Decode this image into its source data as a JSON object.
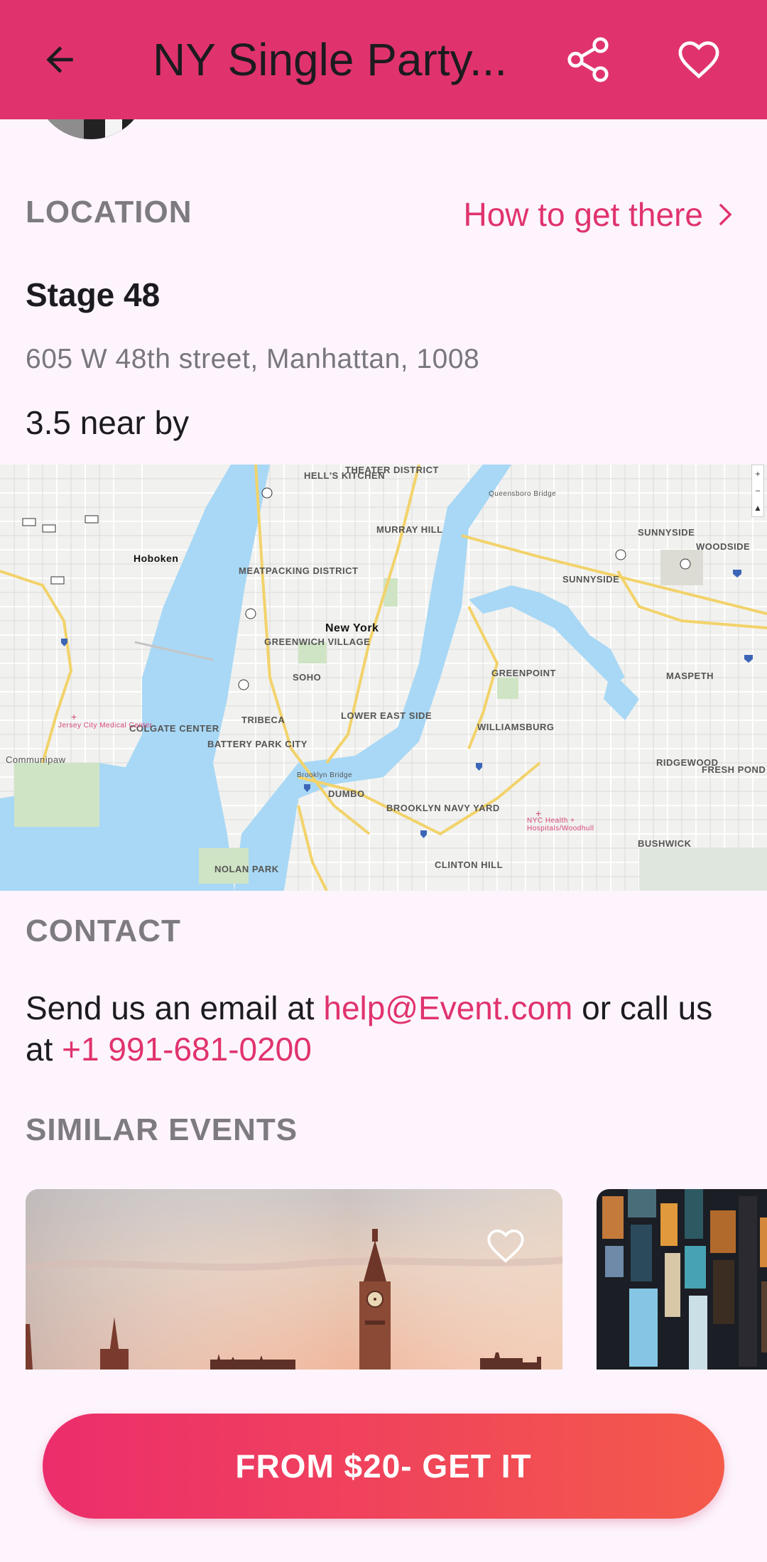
{
  "header": {
    "title": "NY Single Party...",
    "bar_color": "#e0336d"
  },
  "location": {
    "section_label": "LOCATION",
    "directions_link": "How to get there",
    "venue_name": "Stage 48",
    "address": "605 W 48th street, Manhattan, 1008",
    "distance": "3.5 near by"
  },
  "map": {
    "labels": {
      "hells_kitchen": "HELL'S KITCHEN",
      "theater_district": "THEATER DISTRICT",
      "murray_hill": "MURRAY HILL",
      "hoboken": "Hoboken",
      "meatpacking": "MEATPACKING DISTRICT",
      "new_york": "New York",
      "greenwich": "GREENWICH VILLAGE",
      "soho": "SOHO",
      "tribeca": "TRIBECA",
      "lower_east_side": "LOWER EAST SIDE",
      "battery_park": "BATTERY PARK CITY",
      "colgate": "COLGATE CENTER",
      "communipaw": "Communipaw",
      "jersey_city_medical": "Jersey City Medical Center",
      "dumbo": "DUMBO",
      "brooklyn_navy": "BROOKLYN NAVY YARD",
      "williamsburg": "WILLIAMSBURG",
      "greenpoint": "GREENPOINT",
      "sunnyside_1": "SUNNYSIDE",
      "sunnyside_2": "SUNNYSIDE",
      "woodside": "WOODSIDE",
      "maspeth": "MASPETH",
      "ridgewood": "RIDGEWOOD",
      "fresh_pond": "FRESH POND",
      "bushwick": "BUSHWICK",
      "clinton_hill": "CLINTON HILL",
      "nolan_park": "NOLAN PARK",
      "nyc_health": "NYC Health + Hospitals/Woodhull",
      "queensboro": "Queensboro Bridge",
      "brooklyn_bridge": "Brooklyn Bridge"
    },
    "controls": [
      "+",
      "−",
      "▲"
    ]
  },
  "contact": {
    "section_label": "CONTACT",
    "text_before": "Send us an email at ",
    "email": "help@Event.com",
    "text_middle": " or call us at ",
    "phone": "+1 991-681-0200"
  },
  "similar": {
    "section_label": "SIMILAR EVENTS"
  },
  "cta": {
    "label": "FROM $20- GET IT"
  }
}
